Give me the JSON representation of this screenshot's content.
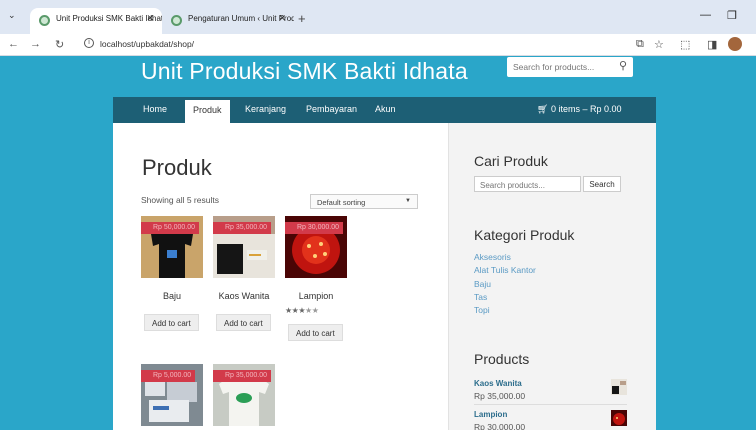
{
  "browser": {
    "tabs": [
      {
        "title": "Unit Produksi SMK Bakti Idhata",
        "active": true
      },
      {
        "title": "Pengaturan Umum ‹ Unit Produksi",
        "active": false
      }
    ],
    "new_tab": "+",
    "url": "localhost/upbakdat/shop/"
  },
  "site": {
    "title": "Unit Produksi SMK Bakti Idhata",
    "search_placeholder": "Search for products..."
  },
  "nav": {
    "items": [
      "Home",
      "Produk",
      "Keranjang",
      "Pembayaran",
      "Akun"
    ],
    "active": "Produk",
    "cart": "0 items – Rp 0.00"
  },
  "main": {
    "title": "Produk",
    "result_count": "Showing all 5 results",
    "sorting": "Default sorting",
    "products": [
      {
        "name": "Baju",
        "price": "Rp 50,000.00",
        "button": "Add to cart",
        "rating": null
      },
      {
        "name": "Kaos Wanita",
        "price": "Rp 35,000.00",
        "button": "Add to cart",
        "rating": null
      },
      {
        "name": "Lampion",
        "price": "Rp 30,000.00",
        "button": "Add to cart",
        "rating": 3
      },
      {
        "name": "",
        "price": "Rp 5,000.00",
        "button": "",
        "rating": null
      },
      {
        "name": "",
        "price": "Rp 35,000.00",
        "button": "",
        "rating": null
      }
    ]
  },
  "sidebar": {
    "search": {
      "title": "Cari Produk",
      "placeholder": "Search products...",
      "button": "Search"
    },
    "categories": {
      "title": "Kategori Produk",
      "items": [
        "Aksesoris",
        "Alat Tulis Kantor",
        "Baju",
        "Tas",
        "Topi"
      ]
    },
    "products": {
      "title": "Products",
      "items": [
        {
          "name": "Kaos Wanita",
          "price": "Rp 35,000.00"
        },
        {
          "name": "Lampion",
          "price": "Rp 30,000.00"
        }
      ]
    }
  },
  "colors": {
    "background": "#2aa6c9",
    "navbar": "#1d5f75",
    "price_tag": "#d23a4a",
    "link": "#5a9ac4"
  }
}
